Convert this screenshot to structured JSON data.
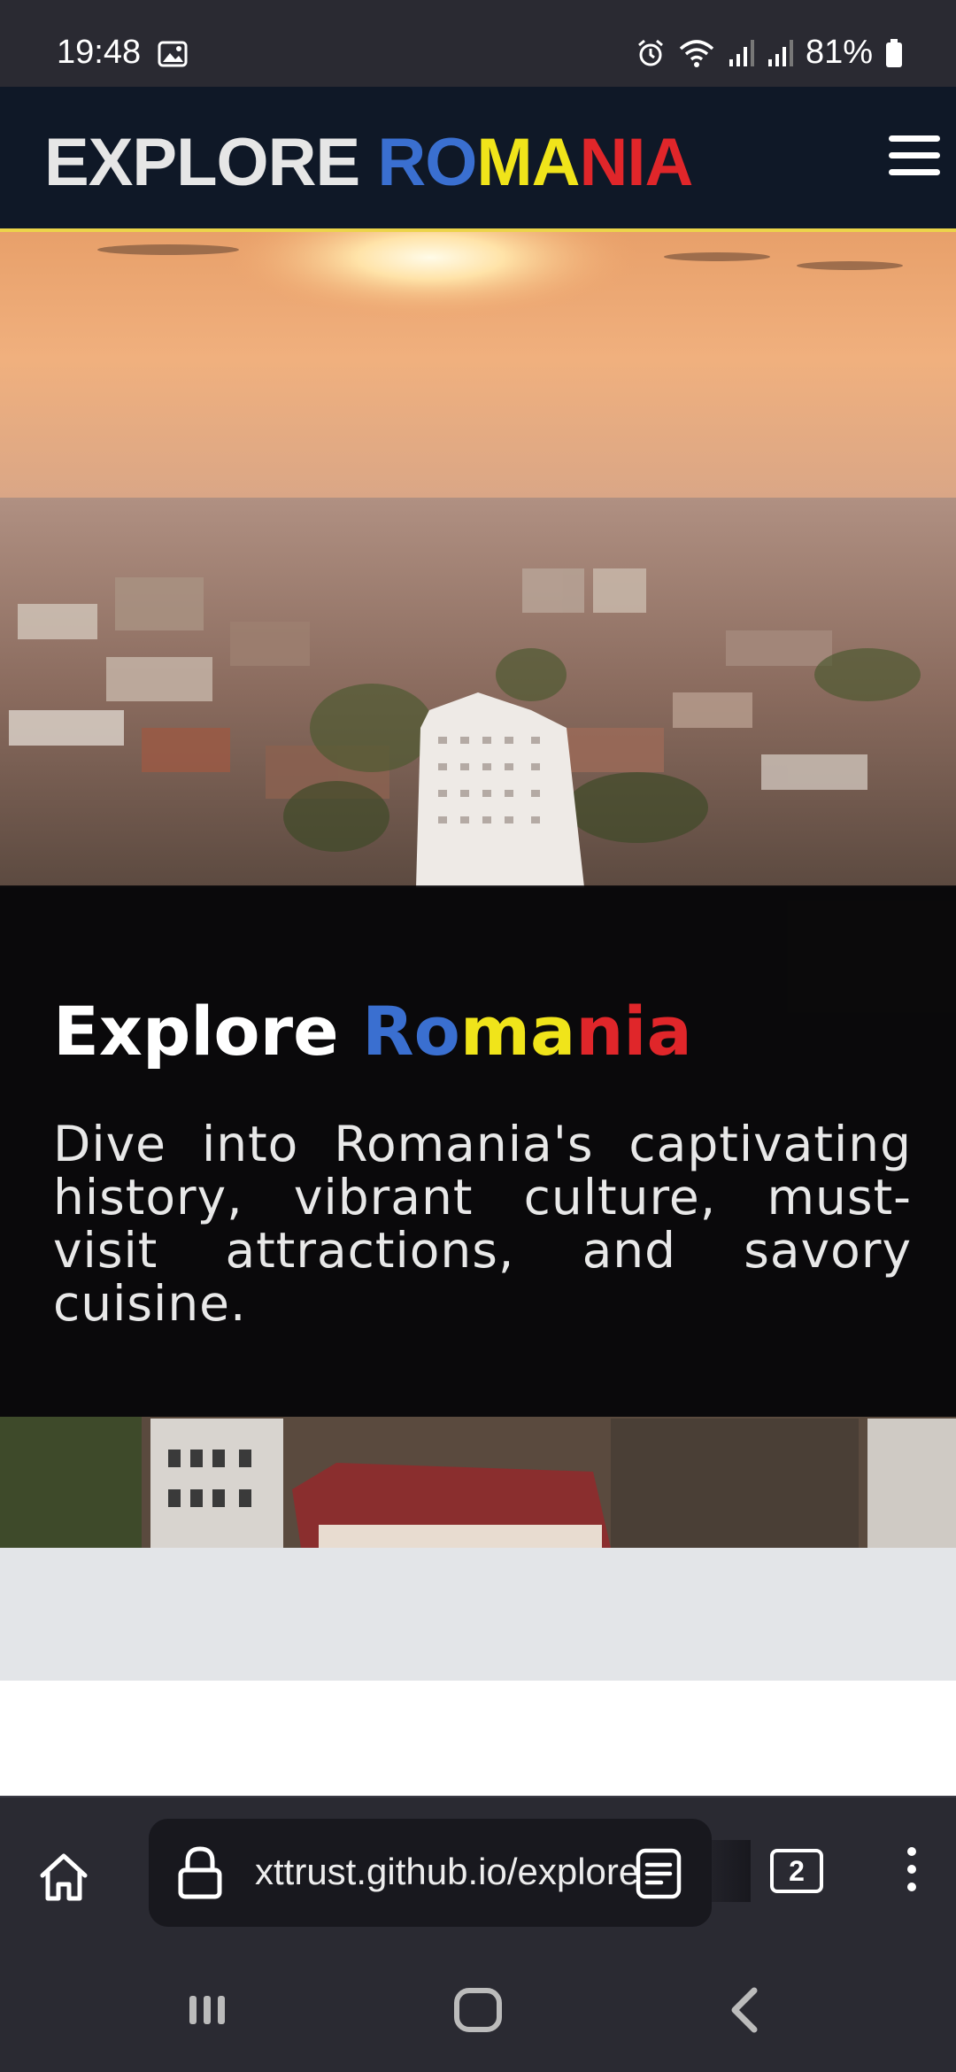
{
  "status_bar": {
    "time": "19:48",
    "battery": "81%",
    "icons": [
      "image-icon",
      "alarm-icon",
      "wifi-icon",
      "signal-icon",
      "signal-icon",
      "battery-icon"
    ]
  },
  "header": {
    "brand_part1": "EXPLORE ",
    "brand_letters": [
      "RO",
      "MA",
      "NIA"
    ],
    "menu_icon": "hamburger-menu-icon"
  },
  "hero": {
    "title_part1": "Explore ",
    "title_letters": [
      "Ro",
      "ma",
      "nia"
    ],
    "description": "Dive into Romania's captivating history, vibrant culture, must-visit attractions, and savory cuisine."
  },
  "browser": {
    "url": "xttrust.github.io/explore",
    "tab_count": "2"
  },
  "colors": {
    "header_bg": "#0f1827",
    "accent_yellow": "#ecd44a",
    "flag_blue": "#3a6fd0",
    "flag_yellow": "#f0e41a",
    "flag_red": "#e0262a",
    "chrome_bg": "#2a2a32"
  }
}
